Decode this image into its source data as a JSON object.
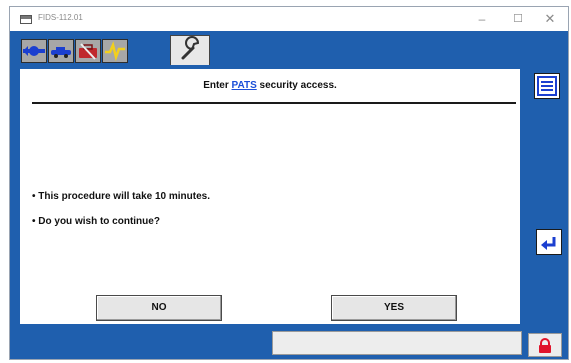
{
  "window": {
    "title": "FIDS-112.01",
    "minimize_label": "–",
    "maximize_label": "☐",
    "close_label": "✕"
  },
  "toolbar": {
    "tools": [
      {
        "icon": "vehicle-connect-icon"
      },
      {
        "icon": "vehicle-icon"
      },
      {
        "icon": "toolbox-icon"
      },
      {
        "icon": "signal-icon"
      }
    ],
    "active_tool": {
      "icon": "wrench-icon"
    }
  },
  "main": {
    "header_prefix": "Enter",
    "header_link": "PATS",
    "header_suffix": "security access.",
    "lines": [
      "• This procedure will take 10 minutes.",
      "• Do you wish to continue?"
    ],
    "no_label": "NO",
    "yes_label": "YES"
  },
  "side": {
    "list_icon": "list-icon",
    "back_icon": "return-icon"
  },
  "status": {
    "text": "",
    "lock_icon": "lock-icon",
    "accent": "#e0142b"
  }
}
